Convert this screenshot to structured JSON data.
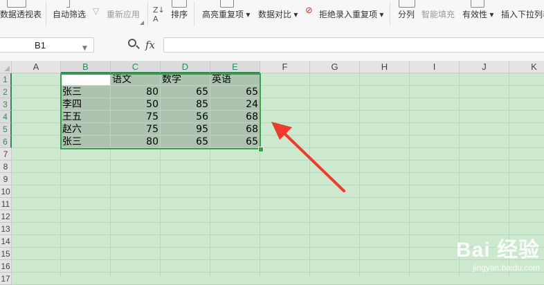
{
  "ribbon": {
    "items": [
      {
        "label": "数据透视表",
        "disabled": false
      },
      {
        "label": "自动筛选",
        "disabled": false
      },
      {
        "label": "重新应用",
        "disabled": true
      },
      {
        "label": "排序",
        "disabled": false
      },
      {
        "label": "高亮重复项 ▾",
        "disabled": false
      },
      {
        "label": "数据对比 ▾",
        "disabled": false
      },
      {
        "label": "拒绝录入重复项 ▾",
        "disabled": false
      },
      {
        "label": "分列",
        "disabled": false
      },
      {
        "label": "智能填充",
        "disabled": true
      },
      {
        "label": "有效性 ▾",
        "disabled": false
      },
      {
        "label": "插入下拉列表",
        "disabled": false
      }
    ]
  },
  "formula_bar": {
    "name_box": "B1",
    "fx_label": "fx",
    "formula": ""
  },
  "sheet": {
    "columns": [
      "A",
      "B",
      "C",
      "D",
      "E",
      "F",
      "G",
      "H",
      "I",
      "J",
      "K"
    ],
    "selected_columns": [
      "B",
      "C",
      "D",
      "E"
    ],
    "rows": [
      "1",
      "2",
      "3",
      "4",
      "5",
      "6",
      "7",
      "8",
      "9",
      "10",
      "11",
      "12",
      "13",
      "14",
      "15",
      "16",
      "17"
    ],
    "selected_rows": [
      "1",
      "2",
      "3",
      "4",
      "5",
      "6"
    ],
    "header": [
      "",
      "语文",
      "数学",
      "英语"
    ],
    "data": [
      [
        "张三",
        "80",
        "65",
        "65"
      ],
      [
        "李四",
        "50",
        "85",
        "24"
      ],
      [
        "王五",
        "75",
        "56",
        "68"
      ],
      [
        "赵六",
        "75",
        "95",
        "68"
      ],
      [
        "张三",
        "80",
        "65",
        "65"
      ]
    ]
  },
  "annotation": {
    "arrow_color": "#f03a2a"
  },
  "watermark": {
    "brand": "Bai 经验",
    "url": "jingyan.baidu.com"
  },
  "colors": {
    "grid_bg": "#cce8cf",
    "selection": "#3aa14b",
    "selected_fill": "#adc3b0"
  }
}
